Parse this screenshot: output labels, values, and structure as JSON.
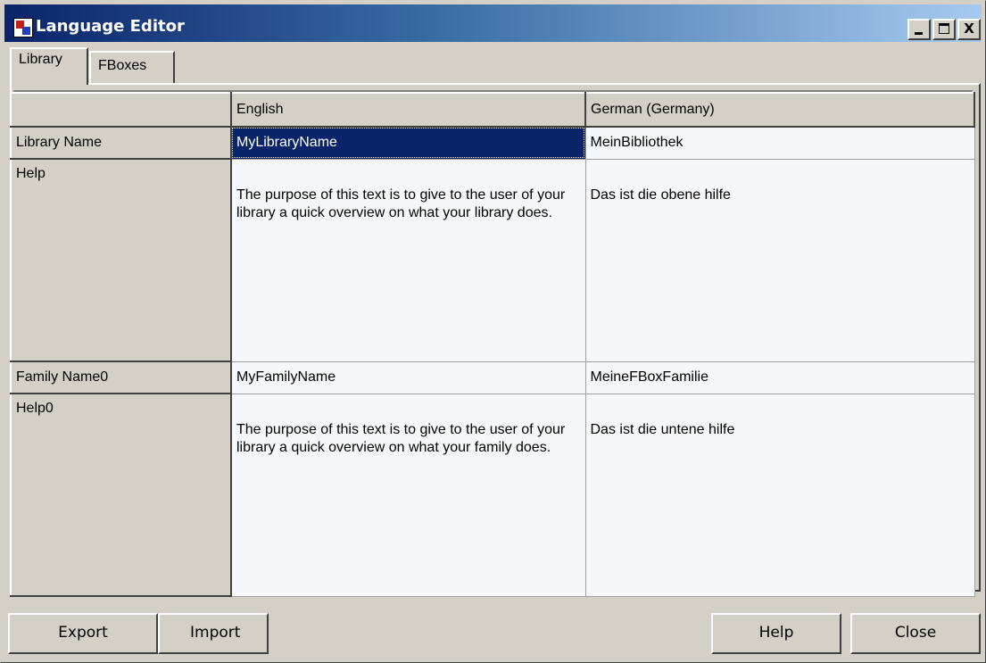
{
  "window": {
    "title": "Language Editor",
    "minimize_label": "",
    "close_label": "X"
  },
  "tabs": [
    {
      "label": "Library",
      "active": true
    },
    {
      "label": "FBoxes",
      "active": false
    }
  ],
  "grid": {
    "columns": [
      "",
      "English",
      "German (Germany)"
    ],
    "rows": [
      {
        "header": "Library Name",
        "english": "MyLibraryName",
        "german": "MeinBibliothek"
      },
      {
        "header": "Help",
        "english": "The purpose of this text is to give to the user of your library a quick overview on what your library does.",
        "german": "Das ist die obene hilfe"
      },
      {
        "header": "Family Name0",
        "english": "MyFamilyName",
        "german": "MeineFBoxFamilie"
      },
      {
        "header": "Help0",
        "english": "The purpose of this text is to give to the user of your library a quick overview on what your family does.",
        "german": "Das ist die untene hilfe"
      }
    ]
  },
  "buttons": {
    "export": "Export",
    "import": "Import",
    "help": "Help",
    "close": "Close"
  }
}
